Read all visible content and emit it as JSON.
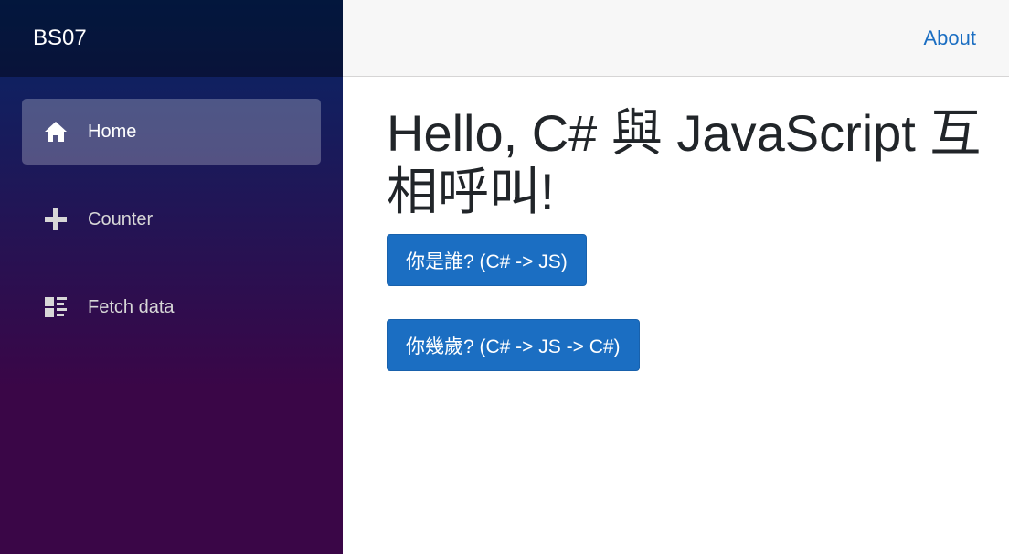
{
  "brand": {
    "title": "BS07"
  },
  "sidebar": {
    "items": [
      {
        "label": "Home",
        "icon": "home-icon",
        "active": true
      },
      {
        "label": "Counter",
        "icon": "plus-icon",
        "active": false
      },
      {
        "label": "Fetch data",
        "icon": "list-rich-icon",
        "active": false
      }
    ]
  },
  "header": {
    "about_label": "About"
  },
  "main": {
    "heading": "Hello, C# 與 JavaScript 互相呼叫!",
    "buttons": [
      {
        "label": "你是誰? (C# -> JS)"
      },
      {
        "label": "你幾歲? (C# -> JS -> C#)"
      }
    ]
  },
  "colors": {
    "accent": "#1b6ec2",
    "sidebar_gradient_top": "#052767",
    "sidebar_gradient_bottom": "#3a0647",
    "top_row_bg": "#f7f7f7"
  }
}
